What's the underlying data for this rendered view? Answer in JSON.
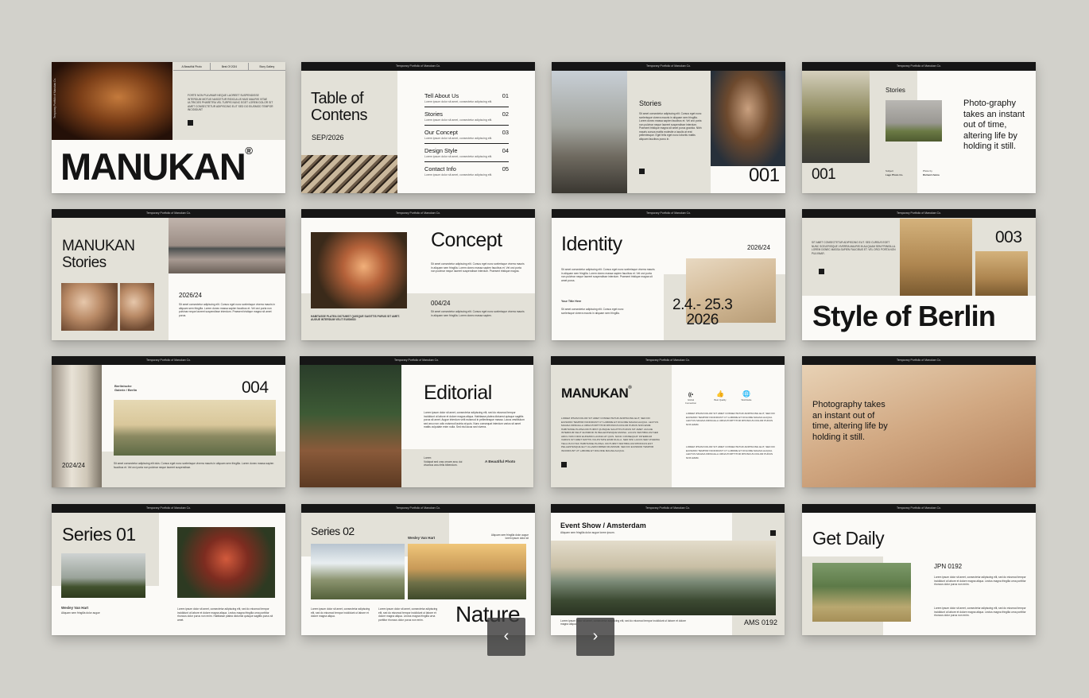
{
  "header_strip": "Temporary Portfolio of Manukan Co.",
  "s1": {
    "tabs": [
      "A Beautiful Photo",
      "Best Of 2024",
      "Story Gallery"
    ],
    "side": "Temporary Portfolio of Manukan Co.",
    "body": "FORTE NON PULVINAR NEQUE LAOREET SUSPENDISSE INTERDUM MOTUS NASCETUR RIDICULUS MUS MAURIS VITAE ULTRICIES PHARETRA VEL TURPIS NUNC EGET LOREM DOLOR SIT AMET CONSECTETUR ADIPISCING ELIT SED DO EIUSMOD TEMPOR INCIDIDUNT",
    "title": "MANUKAN",
    "reg": "®"
  },
  "s2": {
    "title1": "Table of",
    "title2": "Contens",
    "date": "SEP/2026",
    "rows": [
      {
        "label": "Tell About Us",
        "num": "01"
      },
      {
        "label": "Stories",
        "num": "02"
      },
      {
        "label": "Our Concept",
        "num": "03"
      },
      {
        "label": "Design Style",
        "num": "04"
      },
      {
        "label": "Contact Info",
        "num": "05"
      }
    ],
    "row_sub": "Lorem ipsum dolor sit amet, consectetur adipiscing elit."
  },
  "s3": {
    "heading": "Stories",
    "body": "Sit amet consectetur adipiscing elit. Cursus eget nunc scelerisque viverra mauris in aliquam sem fringilla. Lorem donec massa sapien faucibus et. Vel orci porta non pulvinar neque laoreet suspendisse interdum. Praesent tristique magna sit amet purus gravida. Nibh mauris cursus mattis molestie a iaculis at erat pellentesque. Eget felis eget nunc lobortis mattis aliquam faucibus purus in.",
    "num": "001"
  },
  "s4": {
    "heading": "Stories",
    "quote": "Photo-graphy takes an instant out of time, altering life by holding it still.",
    "num": "001",
    "meta1_label": "Subject",
    "meta1_value": "Lago Photo Co.",
    "meta2_label": "Photo by",
    "meta2_value": "Richard Zeima"
  },
  "s5": {
    "title1": "MANUKAN",
    "title2": "Stories",
    "date": "2026/24",
    "body": "Sit amet consectetur adipiscing elit. Cursus eget nunc scelerisque viverra mauris in aliquam sem fringilla. Lorem donec massa sapien faucibus et. Vel orci porta non pulvinar neque laoreet suspendisse interdum. Praesent tristique magna sit amet purus."
  },
  "s6": {
    "title": "Concept",
    "body": "Sit amet consectetur adipiscing elit. Cursus eget nunc scelerisque viverra mauris in aliquam sem fringilla. Lorem donec massa sapien faucibus et. Vel orci porta non pulvinar neque laoreet suspendisse interdum. Praesent tristique magna.",
    "date": "004/24",
    "body2": "Sit amet consectetur adipiscing elit. Cursus eget nunc scelerisque viverra mauris in aliquam sem fringilla. Lorem donec massa sapien.",
    "caption": "HABITASSE PLATEA DICTUMST QUISQUE SAGITTIS PURUS SIT AMET. AUGUE INTERDUM VELIT EUISMOD"
  },
  "s7": {
    "title": "Identity",
    "date": "2026/24",
    "body": "Sit amet consectetur adipiscing elit. Cursus eget nunc scelerisque viverra mauris in aliquam sem fringilla. Lorem donec massa sapien faucibus et. Vel orci porta non pulvinar neque laoreet suspendisse interdum. Praesent tristique magna sit amet purus.",
    "your_title": "Your Title Here",
    "body2": "Sit amet consectetur adipiscing elit. Cursus eget nunc scelerisque viverra mauris in aliquam sem fringilla.",
    "range1": "2.4.- 25.3",
    "range2": "2026"
  },
  "s8": {
    "body": "SIT AMET CONSECTETUR ADIPISCING ELIT. SED CURSUS EGET NUNC SCELERISQUE VIVERRA MAURIS IN ALIQUAM SEM FRINGILLA. LOREM DONEC MASSA SAPIEN FAUCIBUS ET. VEL ORCI PORTA NON PULVINAR.",
    "num": "003",
    "title": "Style of Berlin"
  },
  "s9": {
    "place1": "Berlinische",
    "place2": "Galerie / Berlin",
    "num": "004",
    "date": "2024/24",
    "body": "Sit amet consectetur adipiscing elit duis. Cursus eget nunc scelerisque viverra mauris in aliquam sem fringilla. Lorem donec massa sapien faucibus et. Vel orci porta non pulvinar neque laoreet suspendisse."
  },
  "s10": {
    "title": "Editorial",
    "body": "Lorem ipsum dolor sit amet, consectetur adipiscing elit, sed do eiusmod tempor incididunt ut labore et dolore magna aliqua. Habitasse platea dictumst quisque sagittis purus sit amet. Augue interdum velit euismod in pellentesque massa. Lacus vestibulum sed arcu non odio euismod lacinia at quis. Nunc consequat interdum varius sit amet mattis vulputate enim nulla. Sed nisi lacus sed viverra.",
    "small_label": "Lorem",
    "small_body": "Volutpat sed cras ornare arcu dui vivamus arcu felis bibendum.",
    "caption": "A Beautiful Photo"
  },
  "s11": {
    "title": "MANUKAN",
    "reg": "®",
    "body": "LOREM IPSUM DOLOR SIT AMET CONSECTETUR ADIPISCING ELIT, SED DO EIUSMOD TEMPOR INCIDIDUNT UT LABORE ET DOLORE MAGNA ALIQUA. LECTUS MAGNA FRINGILLA URNA PORTTITOR RHONCUS DOLOR PURUS NON ENIM. HABITASSE PLATEA DICTUMST QUISQUE SAGITTIS PURUS SIT AMET. AUGUE INTERDUM VELIT EUISMOD IN PELLENTESQUE MASSA. LACUS VESTIBULUM SED ARCU NON ODIO EUISMOD LACINIA AT QUIS. NUNC CONSEQUAT INTERDUM VARIUS SIT AMET MATTIS VULPUTATE ENIM NULLA. SED NISI LACUS SED VIVERRA TELLUS IN HAC HABITASSE PLATEA. DICTUMST VESTIBULUM RHONCUS EST PELLENTESQUE ELIT ULLAMCORPER DIGNISSIM. SED DO EIUSMOD TEMPOR INCIDIDUNT UT LABORE ET DOLORE MAGNA ALIQUA.",
    "icons": [
      {
        "icon": "wifi-icon",
        "glyph": "((•",
        "caption": "Global Connection"
      },
      {
        "icon": "thumbs-up-icon",
        "glyph": "👍",
        "caption": "Best Quality"
      },
      {
        "icon": "globe-icon",
        "glyph": "🌐",
        "caption": "Worldwide"
      }
    ],
    "col1": "LOREM IPSUM DOLOR SIT AMET CONSECTETUR ADIPISCING ELIT, SED DO EIUSMOD TEMPOR INCIDIDUNT UT LABORE ET DOLORE MAGNA ALIQUA. LECTUS MAGNA FRINGILLA URNA PORTTITOR RHONCUS DOLOR PURUS NON ENIM.",
    "col2": "LOREM IPSUM DOLOR SIT AMET CONSECTETUR ADIPISCING ELIT, SED DO EIUSMOD TEMPOR INCIDIDUNT UT LABORE ET DOLORE MAGNA ALIQUA. LECTUS MAGNA FRINGILLA URNA PORTTITOR RHONCUS DOLOR PURUS NON ENIM."
  },
  "s12": {
    "quote": "Photography takes an instant out of time, altering life by holding it still."
  },
  "s13": {
    "title": "Series 01",
    "name": "Wesley Van Hart",
    "role": "Aliquam sem fringilla dolor augue",
    "body": "Lorem ipsum dolor sit amet, consectetur adipiscing elit, sed do eiusmod tempor incididunt ut labore et dolore magna aliqua. Lectus magna fringilla urna porttitor rhoncus dolor purus non enim. Habitasse platea dictumst quisque sagittis purus sit amet."
  },
  "s14": {
    "title": "Series 02",
    "name": "Wesley Van Hart",
    "note": "Aliquam sem fringilla dolor augue lorem ipsum dolor sit",
    "body1": "Lorem ipsum dolor sit amet, consectetur adipiscing elit, sed do eiusmod tempor incididunt ut labore et dolore magna aliqua.",
    "body2": "Lorem ipsum dolor sit amet, consectetur adipiscing elit, sed do eiusmod tempor incididunt ut labore et dolore magna aliqua. Lectus magna fringilla urna porttitor rhoncus dolor purus non enim.",
    "word": "Nature"
  },
  "s15": {
    "title": "Event Show / Amsterdam",
    "sub": "Aliquam sem fringilla dolor augue lorem ipsum.",
    "footer": "Lorem ipsum dolor sit amet, consectetur adipiscing elit, sed do eiusmod tempor incididunt ut labore et dolore magna aliqua.",
    "code": "AMS 0192"
  },
  "s16": {
    "title": "Get Daily",
    "code": "JPN 0192",
    "body1": "Lorem ipsum dolor sit amet, consectetur adipiscing elit, sed do eiusmod tempor incididunt ut labore et dolore magna aliqua. Lectus magna fringilla urna porttitor rhoncus dolor purus non enim.",
    "body2": "Lorem ipsum dolor sit amet, consectetur adipiscing elit, sed do eiusmod tempor incididunt ut labore et dolore magna aliqua. Lectus magna fringilla urna porttitor rhoncus dolor purus non enim."
  },
  "nav": {
    "prev": "‹",
    "next": "›"
  }
}
